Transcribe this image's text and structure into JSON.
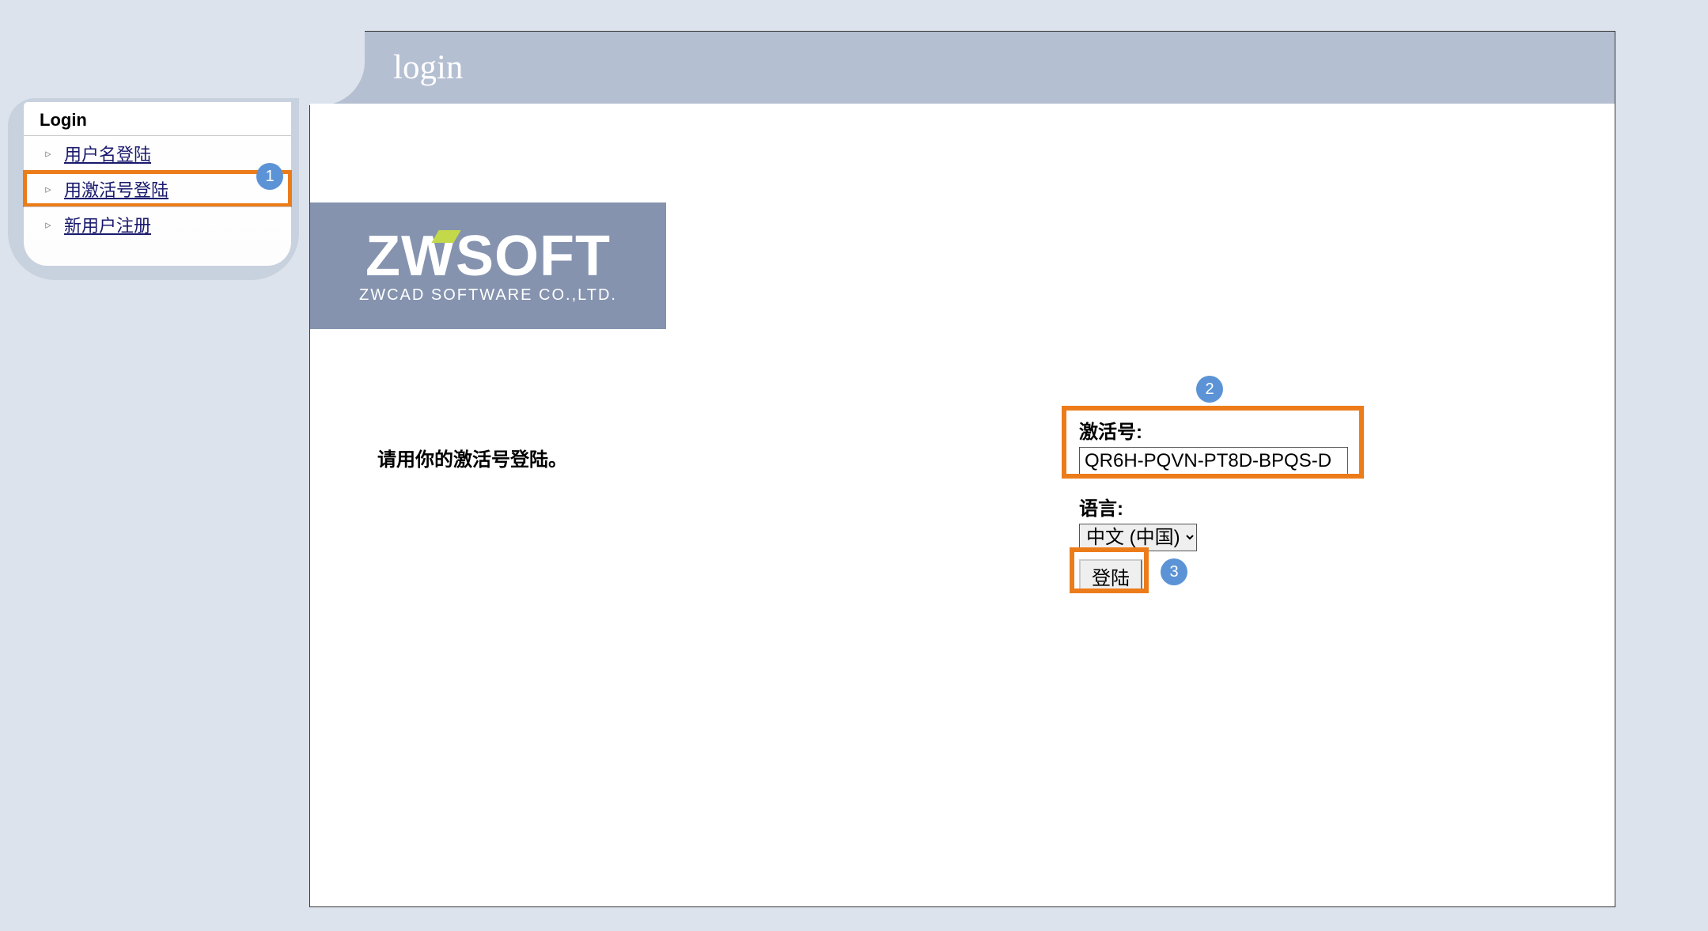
{
  "header": {
    "title": "login"
  },
  "sidebar": {
    "title": "Login",
    "items": [
      {
        "label": "用户名登陆"
      },
      {
        "label": "用激活号登陆"
      },
      {
        "label": "新用户注册"
      }
    ]
  },
  "logo": {
    "main_left": "ZW",
    "main_right": "SOFT",
    "sub": "ZWCAD SOFTWARE CO.,LTD."
  },
  "instruction": "请用你的激活号登陆。",
  "form": {
    "activation_label": "激活号:",
    "activation_value": "QR6H-PQVN-PT8D-BPQS-D",
    "language_label": "语言:",
    "language_value": "中文 (中国)",
    "submit_label": "登陆"
  },
  "annotations": {
    "badge1": "1",
    "badge2": "2",
    "badge3": "3"
  }
}
